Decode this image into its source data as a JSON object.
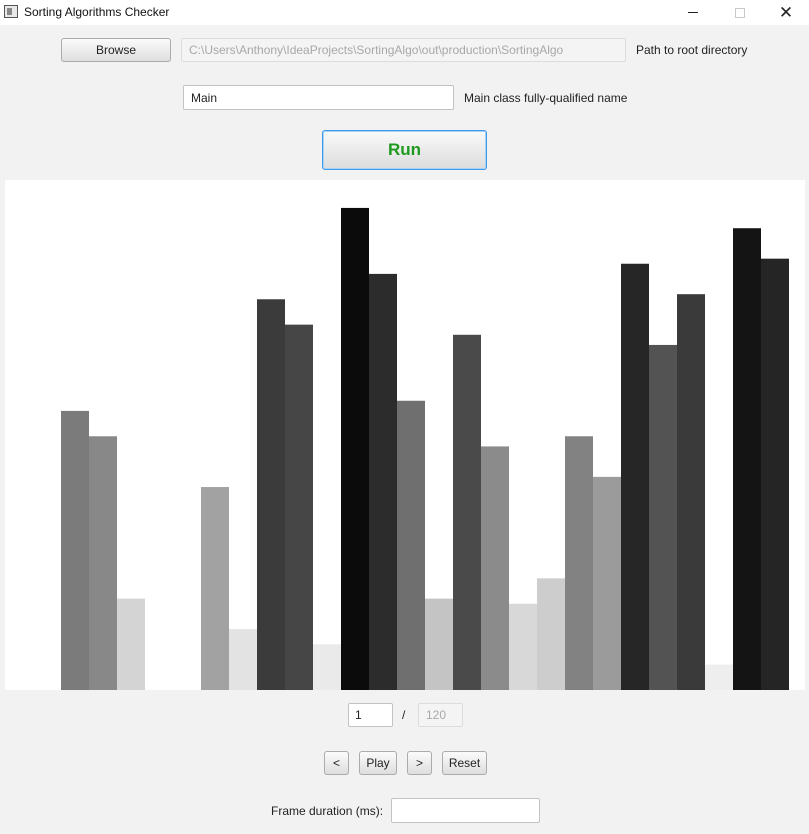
{
  "window": {
    "title": "Sorting Algorithms Checker",
    "minimize_icon": "minimize-icon",
    "maximize_icon": "maximize-icon",
    "close_icon": "close-icon"
  },
  "root_dir": {
    "browse_label": "Browse",
    "path_value": "C:\\Users\\Anthony\\IdeaProjects\\SortingAlgo\\out\\production\\SortingAlgo",
    "path_label": "Path to root directory"
  },
  "main_class": {
    "value": "Main",
    "label": "Main class fully-qualified name"
  },
  "run_button": {
    "label": "Run",
    "color": "#1f9a1f"
  },
  "visualization": {
    "max_value": 100,
    "bar_values": [
      0,
      0,
      55,
      50,
      18,
      0,
      0,
      40,
      12,
      77,
      72,
      9,
      95,
      82,
      57,
      18,
      70,
      48,
      17,
      22,
      50,
      42,
      84,
      68,
      78,
      5,
      91,
      85
    ],
    "bar_shades": [
      "#ffffff",
      "#ffffff",
      "#7b7b7b",
      "#888888",
      "#d4d4d4",
      "#ffffff",
      "#ffffff",
      "#a2a2a2",
      "#e3e3e3",
      "#3b3b3b",
      "#464646",
      "#eaeaea",
      "#0b0b0b",
      "#2c2c2c",
      "#6f6f6f",
      "#c4c4c4",
      "#4a4a4a",
      "#8b8b8b",
      "#d8d8d8",
      "#cdcdcd",
      "#828282",
      "#9b9b9b",
      "#262626",
      "#535353",
      "#3a3a3a",
      "#eeeeee",
      "#141414",
      "#252525"
    ]
  },
  "frame": {
    "current": "1",
    "separator": "/",
    "total": "120"
  },
  "controls": {
    "prev_label": "<",
    "play_label": "Play",
    "next_label": ">",
    "reset_label": "Reset"
  },
  "frame_duration": {
    "label": "Frame duration (ms):",
    "value": ""
  }
}
